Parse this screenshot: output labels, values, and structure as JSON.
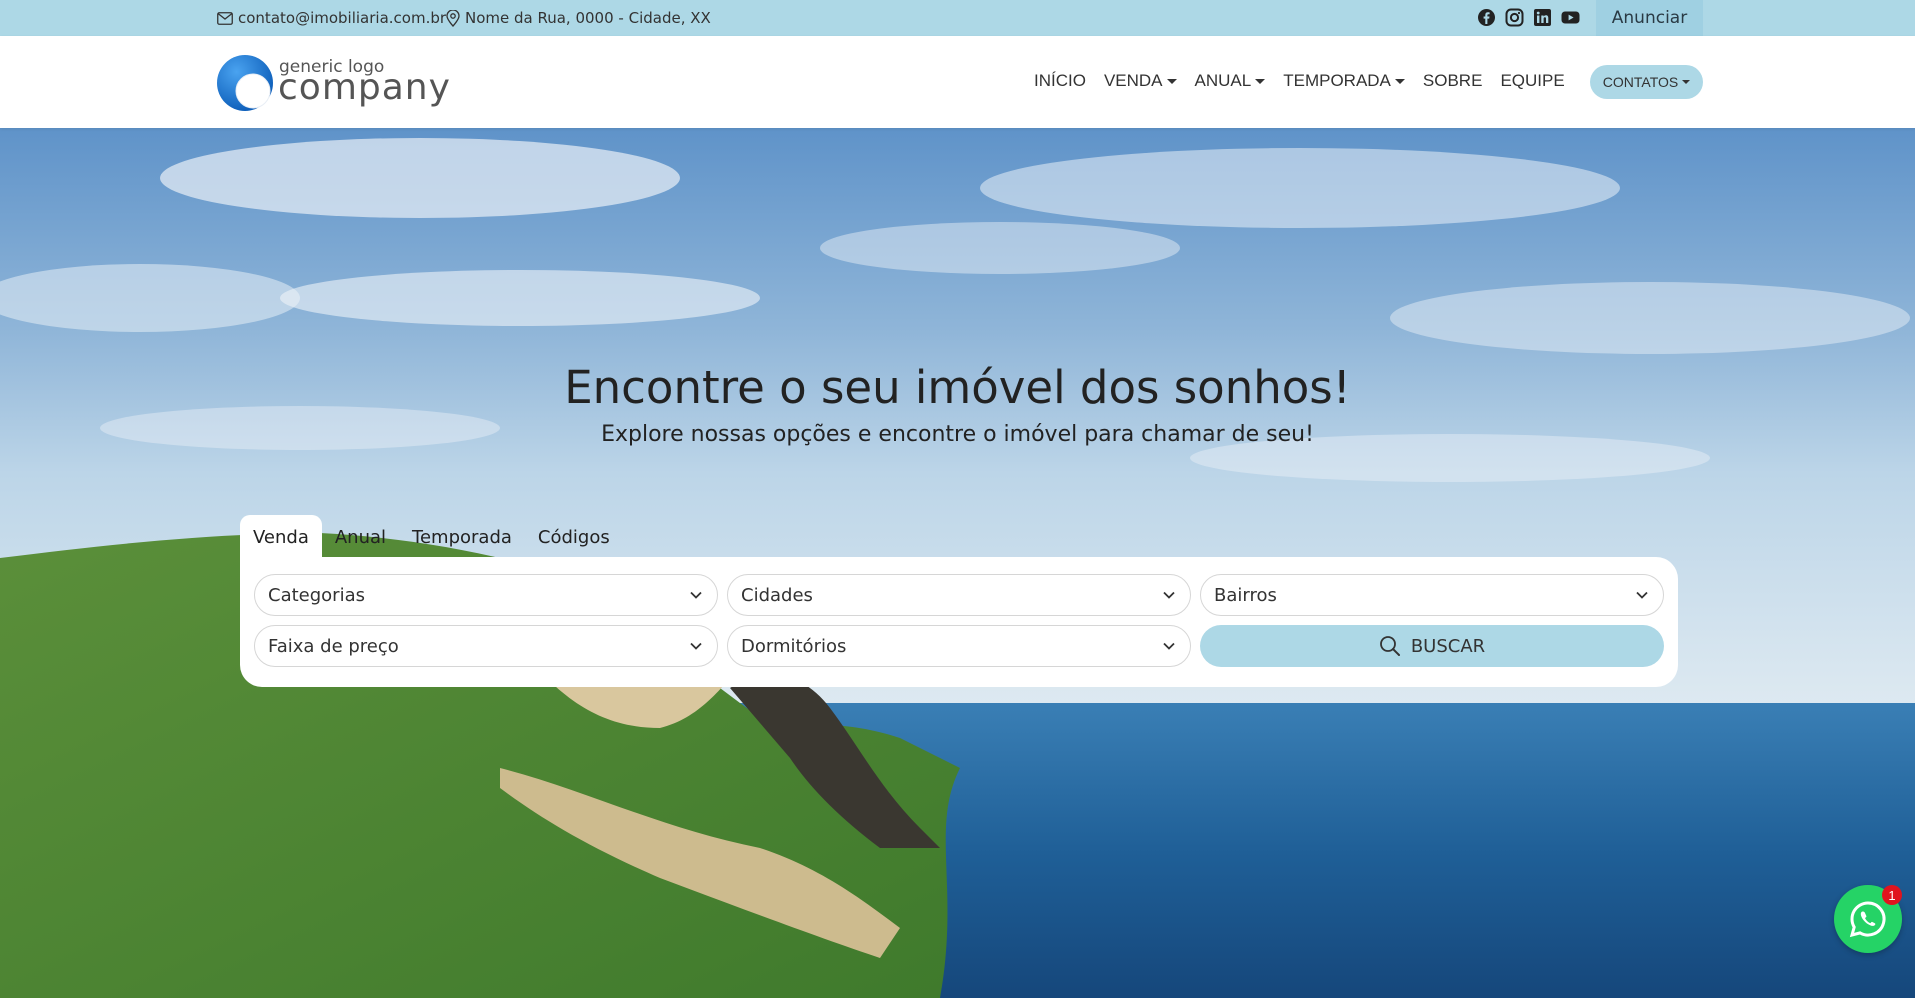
{
  "topbar": {
    "email": "contato@imobiliaria.com.br",
    "address": "Nome da Rua, 0000 - Cidade, XX",
    "social_icons": [
      "facebook-icon",
      "instagram-icon",
      "linkedin-icon",
      "youtube-icon"
    ],
    "cta_label": "Anunciar"
  },
  "logo": {
    "small_text": "generic logo",
    "big_text": "company"
  },
  "nav": {
    "items": [
      {
        "label": "INÍCIO",
        "dropdown": false
      },
      {
        "label": "VENDA",
        "dropdown": true
      },
      {
        "label": "ANUAL",
        "dropdown": true
      },
      {
        "label": "TEMPORADA",
        "dropdown": true
      },
      {
        "label": "SOBRE",
        "dropdown": false
      },
      {
        "label": "EQUIPE",
        "dropdown": false
      }
    ],
    "contacts_label": "CONTATOS"
  },
  "hero": {
    "title": "Encontre o seu imóvel dos sonhos!",
    "subtitle": "Explore nossas opções e encontre o imóvel para chamar de seu!"
  },
  "search": {
    "tabs": [
      "Venda",
      "Anual",
      "Temporada",
      "Códigos"
    ],
    "active_tab": "Venda",
    "fields": {
      "categorias": "Categorias",
      "cidades": "Cidades",
      "bairros": "Bairros",
      "preco": "Faixa de preço",
      "dormitorios": "Dormitórios"
    },
    "button_label": "BUSCAR"
  },
  "whatsapp": {
    "badge": "1"
  },
  "colors": {
    "accent": "#add8e6",
    "whatsapp": "#25d366",
    "badge": "#e0141e"
  }
}
